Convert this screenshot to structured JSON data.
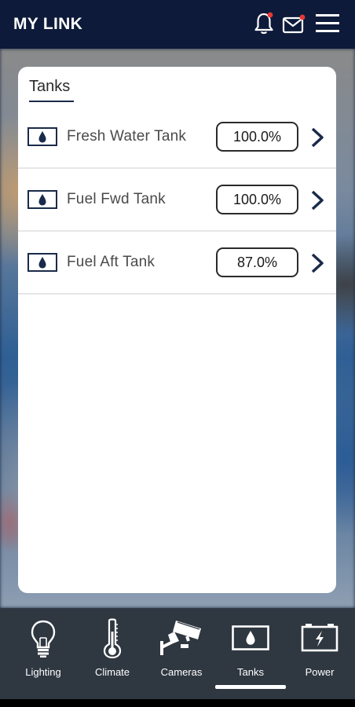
{
  "header": {
    "title": "MY LINK",
    "icons": [
      "bell-icon",
      "mail-icon",
      "hamburger-menu-icon"
    ],
    "notification_dot_color": "#e53935"
  },
  "tanks_card": {
    "title": "Tanks",
    "rows": [
      {
        "name": "Fresh Water Tank",
        "value": "100.0%",
        "icon": "water-drop-icon"
      },
      {
        "name": "Fuel Fwd Tank",
        "value": "100.0%",
        "icon": "water-drop-icon"
      },
      {
        "name": "Fuel Aft Tank",
        "value": "87.0%",
        "icon": "water-drop-icon"
      }
    ]
  },
  "bottom_nav": {
    "items": [
      {
        "label": "Lighting",
        "icon": "lightbulb-icon"
      },
      {
        "label": "Climate",
        "icon": "thermometer-icon"
      },
      {
        "label": "Cameras",
        "icon": "security-camera-icon"
      },
      {
        "label": "Tanks",
        "icon": "tank-icon"
      },
      {
        "label": "Power",
        "icon": "battery-icon"
      }
    ],
    "active": "Tanks"
  },
  "colors": {
    "header_bg": "#0e1a3a",
    "nav_bg": "#303842",
    "card_bg": "#ffffff"
  }
}
